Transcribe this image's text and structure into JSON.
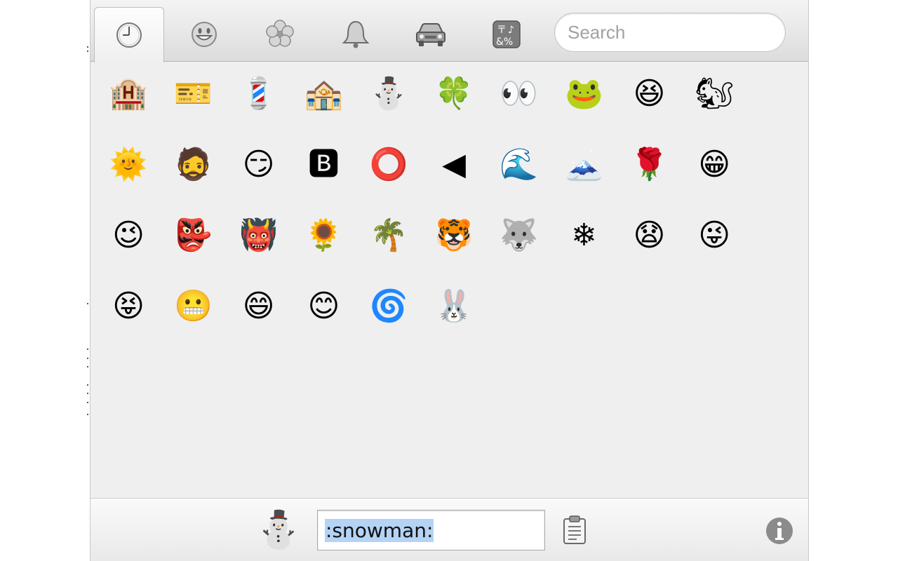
{
  "toolbar": {
    "tabs": [
      {
        "name": "recent",
        "icon": "clock-icon",
        "active": true
      },
      {
        "name": "people",
        "icon": "smiley-icon",
        "active": false
      },
      {
        "name": "nature",
        "icon": "flower-icon",
        "active": false
      },
      {
        "name": "objects",
        "icon": "bell-icon",
        "active": false
      },
      {
        "name": "places",
        "icon": "car-icon",
        "active": false
      },
      {
        "name": "symbols",
        "icon": "symbols-icon",
        "active": false
      }
    ],
    "search_placeholder": "Search"
  },
  "grid": {
    "items": [
      {
        "glyph": "🏨",
        "label": "hotel"
      },
      {
        "glyph": "🎫",
        "label": "ticket"
      },
      {
        "glyph": "💈",
        "label": "barber pole"
      },
      {
        "glyph": "🏤",
        "label": "post office"
      },
      {
        "glyph": "⛄",
        "label": "snowman"
      },
      {
        "glyph": "🍀",
        "label": "four leaf clover"
      },
      {
        "glyph": "👀",
        "label": "eyes"
      },
      {
        "glyph": "🐸",
        "label": "frog"
      },
      {
        "glyph": "😆",
        "label": "laughing"
      },
      {
        "glyph": "🐿",
        "label": "squirrel"
      },
      {
        "glyph": "🌞",
        "label": "sun with face"
      },
      {
        "glyph": "🧔",
        "label": "bearded person"
      },
      {
        "glyph": "😏",
        "label": "troll face"
      },
      {
        "glyph": "🅱",
        "label": "b button"
      },
      {
        "glyph": "⭕",
        "label": "o"
      },
      {
        "glyph": "◀",
        "label": "arrow backward"
      },
      {
        "glyph": "🌊",
        "label": "ocean"
      },
      {
        "glyph": "🗻",
        "label": "mount fuji"
      },
      {
        "glyph": "🌹",
        "label": "rose"
      },
      {
        "glyph": "😁",
        "label": "grin"
      },
      {
        "glyph": "😉",
        "label": "wink"
      },
      {
        "glyph": "👺",
        "label": "goblin"
      },
      {
        "glyph": "👹",
        "label": "ogre"
      },
      {
        "glyph": "🌻",
        "label": "sunflower"
      },
      {
        "glyph": "🌴",
        "label": "palm tree"
      },
      {
        "glyph": "🐯",
        "label": "tiger"
      },
      {
        "glyph": "🐺",
        "label": "wolf"
      },
      {
        "glyph": "❄",
        "label": "snowflake"
      },
      {
        "glyph": "😧",
        "label": "anguished"
      },
      {
        "glyph": "😜",
        "label": "stuck out tongue winking eye"
      },
      {
        "glyph": "😝",
        "label": "stuck out tongue closed eyes"
      },
      {
        "glyph": "😬",
        "label": "grimacing"
      },
      {
        "glyph": "😄",
        "label": "smile"
      },
      {
        "glyph": "😊",
        "label": "blush"
      },
      {
        "glyph": "🌀",
        "label": "cyclone"
      },
      {
        "glyph": "🐰",
        "label": "rabbit"
      }
    ]
  },
  "bottom": {
    "preview_glyph": "⛄",
    "name_value": ":snowman:",
    "copy_icon": "clipboard-icon",
    "info_icon": "info-icon"
  }
}
